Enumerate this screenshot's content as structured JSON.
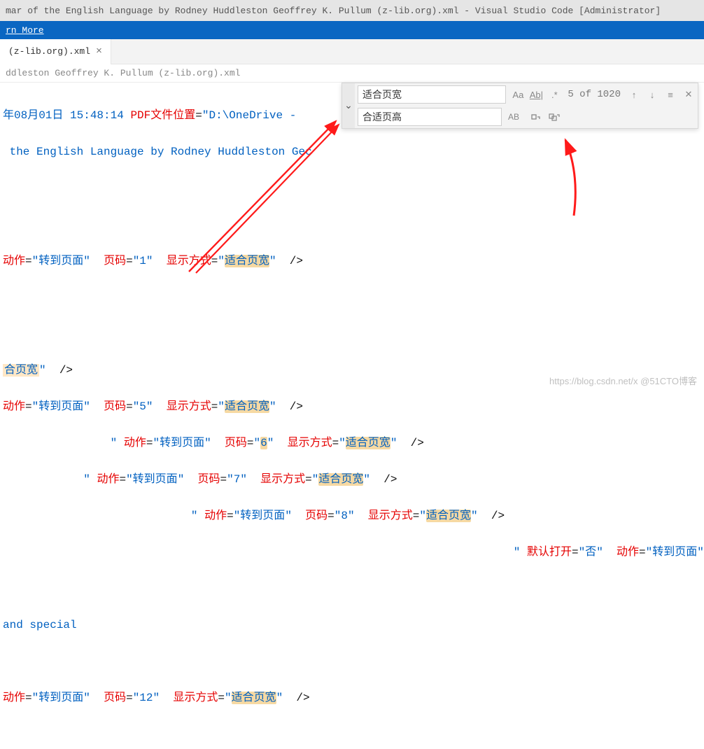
{
  "window": {
    "title": "mar of the English Language by Rodney Huddleston Geoffrey K. Pullum (z-lib.org).xml - Visual Studio Code [Administrator]"
  },
  "banner": {
    "learn_more": "rn More"
  },
  "tab": {
    "label": "(z-lib.org).xml",
    "close": "×"
  },
  "breadcrumb": "ddleston Geoffrey K. Pullum (z-lib.org).xml",
  "find": {
    "search_value": "适合页宽",
    "replace_value": "合适页高",
    "count": "5 of 1020",
    "opt_case": "Aa",
    "opt_word": "Ab|",
    "opt_regex": ".*",
    "opt_preserve": "AB"
  },
  "code": {
    "l1a": "年08月01日 15:48:14",
    "l1attr": "PDF文件位置",
    "l1eq": "=",
    "l1q": "\"",
    "l1val": "D:\\OneDrive -",
    "l2": " the English Language by Rodney Huddleston Gec",
    "attr_action": "动作",
    "val_goto": "转到页面",
    "attr_page": "页码",
    "attr_mode": "显示方式",
    "val_mode": "适合页宽",
    "val_mode_hl": "适合页宽",
    "attr_default": "默认打开",
    "val_no": "否",
    "trail_page": "页",
    "tag_close": "/>",
    "p1": "1",
    "p5": "5",
    "p6": "6",
    "p7": "7",
    "p8": "8",
    "p12": "12",
    "special": "and special"
  },
  "watermark": "https://blog.csdn.net/x @51CTO博客"
}
